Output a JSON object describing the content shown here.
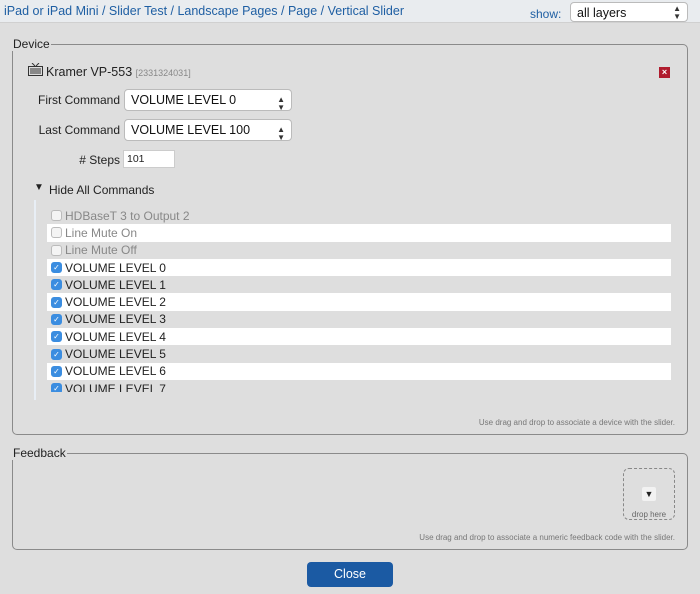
{
  "header": {
    "breadcrumb": "iPad or iPad Mini / Slider Test / Landscape Pages / Page / Vertical Slider",
    "show_label": "show:",
    "show_value": "all layers"
  },
  "device": {
    "legend": "Device",
    "name": "Kramer VP-553",
    "id": "[2331324031]",
    "first_command_label": "First Command",
    "first_command_value": "VOLUME LEVEL 0",
    "last_command_label": "Last Command",
    "last_command_value": "VOLUME LEVEL 100",
    "steps_label": "# Steps",
    "steps_value": "101",
    "toggle_label": "Hide All Commands",
    "commands": [
      {
        "label": "HDBaseT 3 to Output 2",
        "checked": false
      },
      {
        "label": "Line Mute On",
        "checked": false
      },
      {
        "label": "Line Mute Off",
        "checked": false
      },
      {
        "label": "VOLUME LEVEL 0",
        "checked": true
      },
      {
        "label": "VOLUME LEVEL 1",
        "checked": true
      },
      {
        "label": "VOLUME LEVEL 2",
        "checked": true
      },
      {
        "label": "VOLUME LEVEL 3",
        "checked": true
      },
      {
        "label": "VOLUME LEVEL 4",
        "checked": true
      },
      {
        "label": "VOLUME LEVEL 5",
        "checked": true
      },
      {
        "label": "VOLUME LEVEL 6",
        "checked": true
      },
      {
        "label": "VOLUME LEVEL 7",
        "checked": true
      }
    ],
    "hint": "Use drag and drop to associate a device with the slider."
  },
  "feedback": {
    "legend": "Feedback",
    "drop_label": "drop here",
    "hint": "Use drag and drop to associate a numeric feedback code with the slider."
  },
  "close_label": "Close"
}
